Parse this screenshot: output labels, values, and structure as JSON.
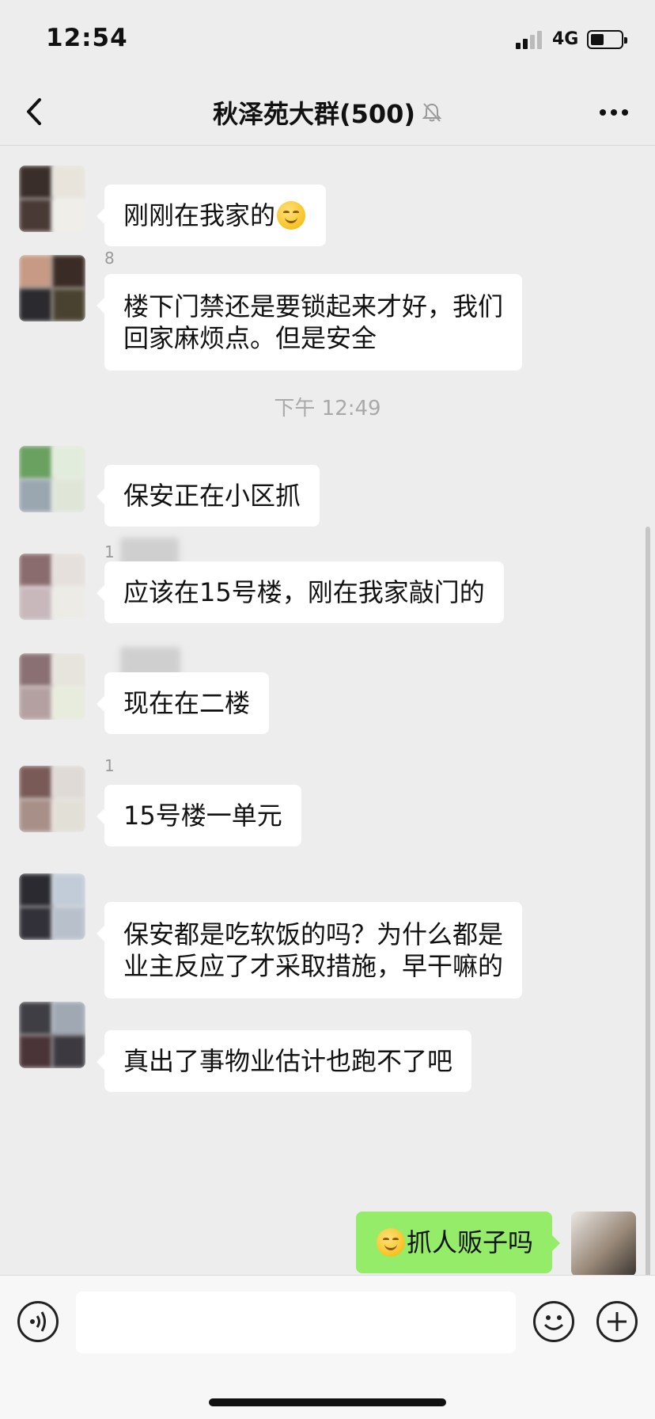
{
  "status_bar": {
    "time": "12:54",
    "network": "4G"
  },
  "nav": {
    "title": "秋泽苑大群(500)"
  },
  "messages": [
    {
      "id": 1,
      "sender": "",
      "text_lines": [
        "刚刚在我家的"
      ],
      "emoji": "crying-laughing-emoji"
    },
    {
      "id": 2,
      "sender": "8",
      "text_lines": [
        "楼下门禁还是要锁起来才好，我们",
        "回家麻烦点。但是安全"
      ]
    },
    {
      "id": 3,
      "sender": "",
      "text_lines": [
        "保安正在小区抓"
      ]
    },
    {
      "id": 4,
      "sender": "1",
      "text_lines": [
        "应该在15号楼，刚在我家敲门的"
      ]
    },
    {
      "id": 5,
      "sender": "",
      "text_lines": [
        "现在在二楼"
      ]
    },
    {
      "id": 6,
      "sender": "1",
      "text_lines": [
        "15号楼一单元"
      ]
    },
    {
      "id": 7,
      "sender": "",
      "text_lines": [
        "保安都是吃软饭的吗？为什么都是",
        "业主反应了才采取措施，早干嘛的"
      ]
    },
    {
      "id": 8,
      "sender": "",
      "text_lines": [
        "真出了事物业估计也跑不了吧"
      ]
    },
    {
      "id": 9,
      "sender": "me",
      "text_lines": [
        "抓人贩子吗"
      ],
      "emoji": "smiling-emoji"
    }
  ],
  "timestamp": "下午 12:49",
  "input": {
    "value": "",
    "placeholder": ""
  },
  "colors": {
    "background": "#ededed",
    "bubble_other": "#ffffff",
    "bubble_mine": "#95ec69",
    "timestamp": "#a9a9a9"
  }
}
